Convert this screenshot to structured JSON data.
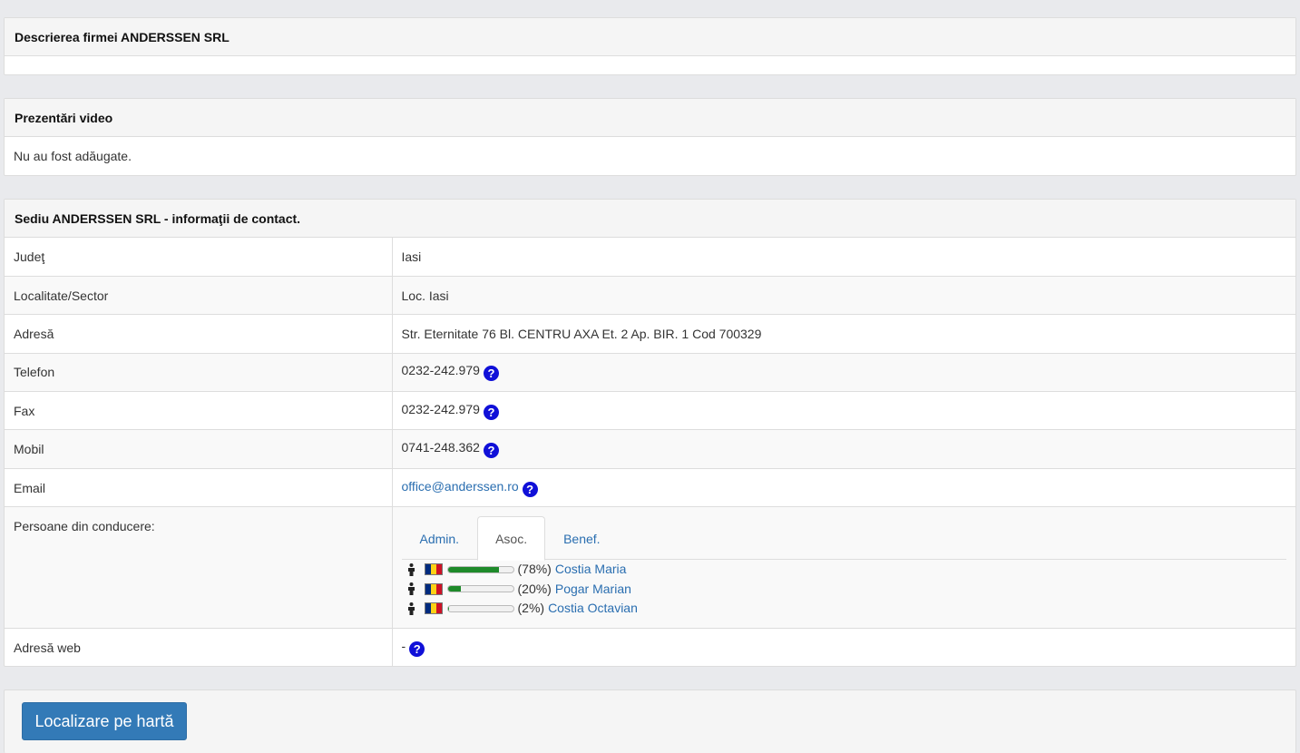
{
  "description_panel": {
    "title": "Descrierea firmei ANDERSSEN SRL"
  },
  "video_panel": {
    "title": "Prezentări video",
    "body": "Nu au fost adăugate."
  },
  "contact_panel": {
    "title": "Sediu ANDERSSEN SRL - informaţii de contact.",
    "rows": {
      "judet": {
        "label": "Judeţ",
        "value": "Iasi"
      },
      "localitate": {
        "label": "Localitate/Sector",
        "value": "Loc. Iasi"
      },
      "adresa": {
        "label": "Adresă",
        "value": "Str. Eternitate 76 Bl. CENTRU AXA Et. 2 Ap. BIR. 1 Cod 700329"
      },
      "telefon": {
        "label": "Telefon",
        "value": "0232-242.979"
      },
      "fax": {
        "label": "Fax",
        "value": "0232-242.979"
      },
      "mobil": {
        "label": "Mobil",
        "value": "0741-248.362"
      },
      "email": {
        "label": "Email",
        "value": "office@anderssen.ro"
      },
      "persoane": {
        "label": "Persoane din conducere:"
      },
      "web": {
        "label": "Adresă web",
        "value": "-"
      }
    },
    "help_glyph": "?",
    "tabs": {
      "admin": "Admin.",
      "asoc": "Asoc.",
      "benef": "Benef."
    },
    "active_tab": "Asoc.",
    "associates": [
      {
        "percent_label": "(78%)",
        "share": 78,
        "name": "Costia Maria"
      },
      {
        "percent_label": "(20%)",
        "share": 20,
        "name": "Pogar Marian"
      },
      {
        "percent_label": "(2%)",
        "share": 2,
        "name": "Costia Octavian"
      }
    ],
    "flag_colors": [
      "#002b7f",
      "#fcd116",
      "#ce1126"
    ],
    "bar_color": "#1e8a2a",
    "icons": {
      "person": "person-icon",
      "flag": "romania-flag-icon",
      "help": "help-circle-icon"
    }
  },
  "map_button": {
    "label": "Localizare pe hartă",
    "color": "#337ab7"
  }
}
